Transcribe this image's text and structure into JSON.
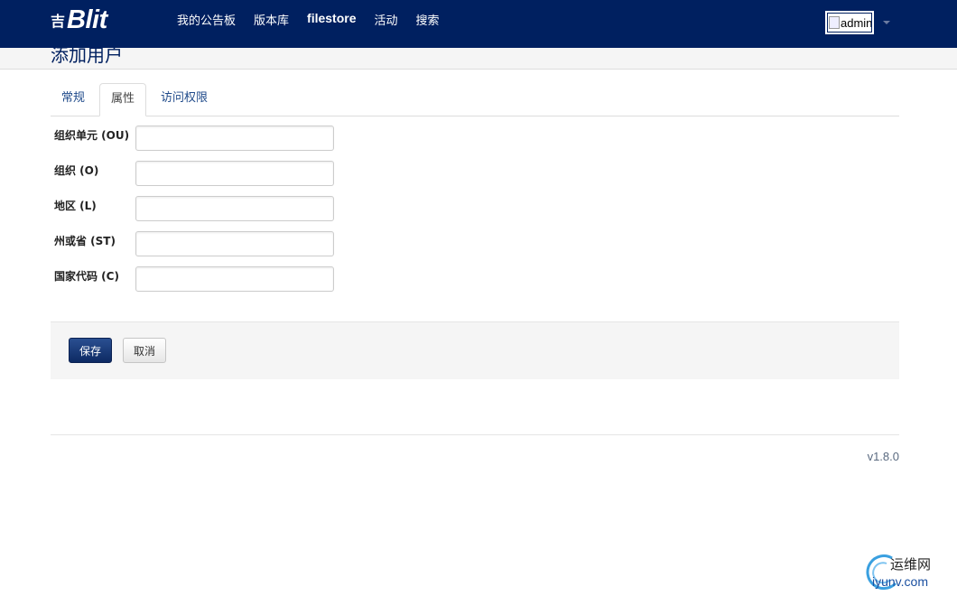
{
  "brand": {
    "mark": "吉",
    "name": "Blit",
    "color": "#002060"
  },
  "nav": {
    "items": [
      {
        "label": "我的公告板"
      },
      {
        "label": "版本库"
      },
      {
        "label": "filestore"
      },
      {
        "label": "活动"
      },
      {
        "label": "搜索"
      }
    ]
  },
  "user": {
    "avatar_alt": "admin"
  },
  "page": {
    "title": "添加用户"
  },
  "tabs": [
    {
      "label": "常规",
      "active": false
    },
    {
      "label": "属性",
      "active": true
    },
    {
      "label": "访问权限",
      "active": false
    }
  ],
  "form": {
    "fields": [
      {
        "label": "组织单元 (OU)",
        "value": ""
      },
      {
        "label": "组织 (O)",
        "value": ""
      },
      {
        "label": "地区 (L)",
        "value": ""
      },
      {
        "label": "州或省 (ST)",
        "value": ""
      },
      {
        "label": "国家代码 (C)",
        "value": ""
      }
    ]
  },
  "actions": {
    "save_label": "保存",
    "cancel_label": "取消"
  },
  "footer": {
    "version": "v1.8.0"
  },
  "watermark": {
    "line1": "运维网",
    "line2": "iyunv.com"
  }
}
